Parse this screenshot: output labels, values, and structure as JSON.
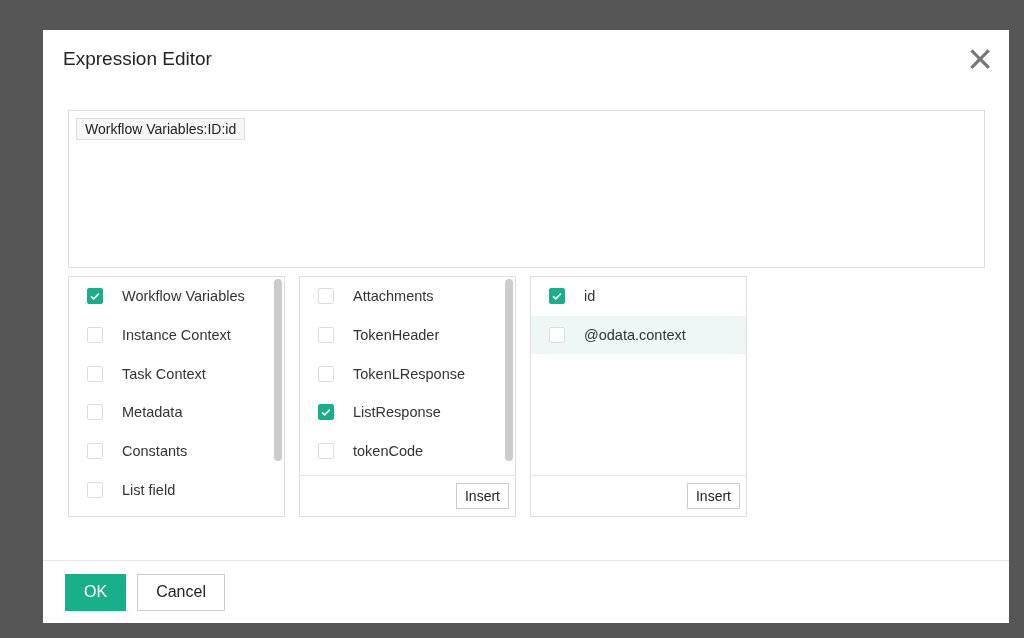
{
  "dialog": {
    "title": "Expression Editor",
    "close": "×"
  },
  "expression": {
    "tokens": [
      "Workflow Variables:ID:id"
    ]
  },
  "lists": [
    {
      "scrollbar": true,
      "items": [
        {
          "label": "Workflow Variables",
          "checked": true,
          "highlighted": false
        },
        {
          "label": "Instance Context",
          "checked": false,
          "highlighted": false
        },
        {
          "label": "Task Context",
          "checked": false,
          "highlighted": false
        },
        {
          "label": "Metadata",
          "checked": false,
          "highlighted": false
        },
        {
          "label": "Constants",
          "checked": false,
          "highlighted": false
        },
        {
          "label": "List field",
          "checked": false,
          "highlighted": false
        }
      ]
    },
    {
      "scrollbar": true,
      "button": "Insert",
      "items": [
        {
          "label": "Attachments",
          "checked": false,
          "highlighted": false
        },
        {
          "label": "TokenHeader",
          "checked": false,
          "highlighted": false
        },
        {
          "label": "TokenLResponse",
          "checked": false,
          "highlighted": false
        },
        {
          "label": "ListResponse",
          "checked": true,
          "highlighted": false
        },
        {
          "label": "tokenCode",
          "checked": false,
          "highlighted": false
        }
      ]
    },
    {
      "scrollbar": false,
      "button": "Insert",
      "items": [
        {
          "label": "id",
          "checked": true,
          "highlighted": false
        },
        {
          "label": "@odata.context",
          "checked": false,
          "highlighted": true
        }
      ]
    }
  ],
  "buttons": [
    {
      "label": "OK",
      "kind": "primary"
    },
    {
      "label": "Cancel",
      "kind": "secondary"
    }
  ]
}
